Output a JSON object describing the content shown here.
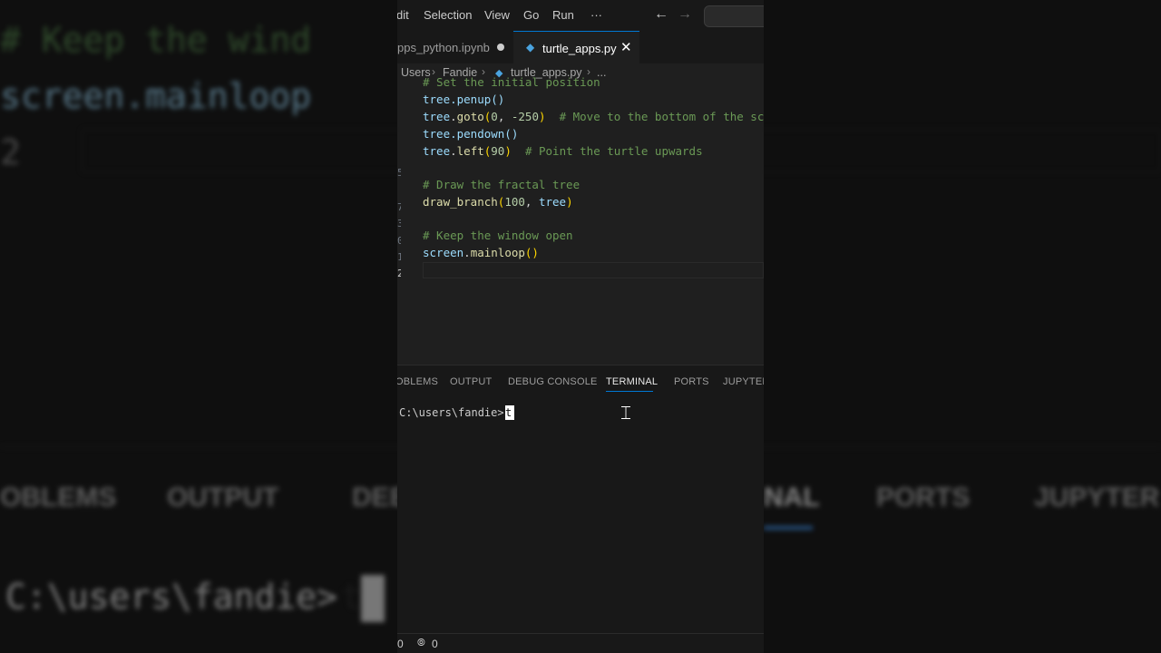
{
  "menu": {
    "items": [
      "dit",
      "Selection",
      "View",
      "Go",
      "Run",
      "···"
    ],
    "back_icon": "arrow-left-icon",
    "forward_icon": "arrow-right-icon"
  },
  "tabs": [
    {
      "label": "pps_python.ipynb",
      "state": "modified"
    },
    {
      "label": "turtle_apps.py",
      "state": "active"
    }
  ],
  "breadcrumb": [
    "Users",
    "Fandie",
    "turtle_apps.py",
    "..."
  ],
  "editor": {
    "line_numbers": [
      "",
      "",
      "",
      "",
      "5",
      "",
      "7",
      "3",
      "",
      "0",
      "1",
      "2"
    ],
    "lines": [
      "# Set the initial position",
      "tree.penup()",
      "tree.goto(0, -250)  # Move to the bottom of the sc",
      "tree.pendown()",
      "tree.left(90)  # Point the turtle upwards",
      "",
      "# Draw the fractal tree",
      "draw_branch(100, tree)",
      "",
      "# Keep the window open",
      "screen.mainloop()",
      ""
    ]
  },
  "panel": {
    "tabs": [
      "OBLEMS",
      "OUTPUT",
      "DEBUG CONSOLE",
      "TERMINAL",
      "PORTS",
      "JUPYTER"
    ],
    "active_tab": "TERMINAL",
    "terminal": {
      "prompt": "C:\\users\\fandie>",
      "typed": "t"
    }
  },
  "statusbar": {
    "errors": "0",
    "ports": "0"
  },
  "background": {
    "code": [
      "# Keep the wind",
      "screen.mainloop",
      "2"
    ],
    "tabs": [
      "OBLEMS",
      "OUTPUT",
      "DEB",
      "NAL",
      "PORTS",
      "JUPYTER"
    ],
    "prompt": "C:\\users\\fandie>",
    "typed": "t"
  },
  "colors": {
    "accent": "#0078d4",
    "comment": "#6a9955",
    "variable": "#9cdcfe",
    "function": "#dcdcaa",
    "number": "#b5cea8"
  }
}
